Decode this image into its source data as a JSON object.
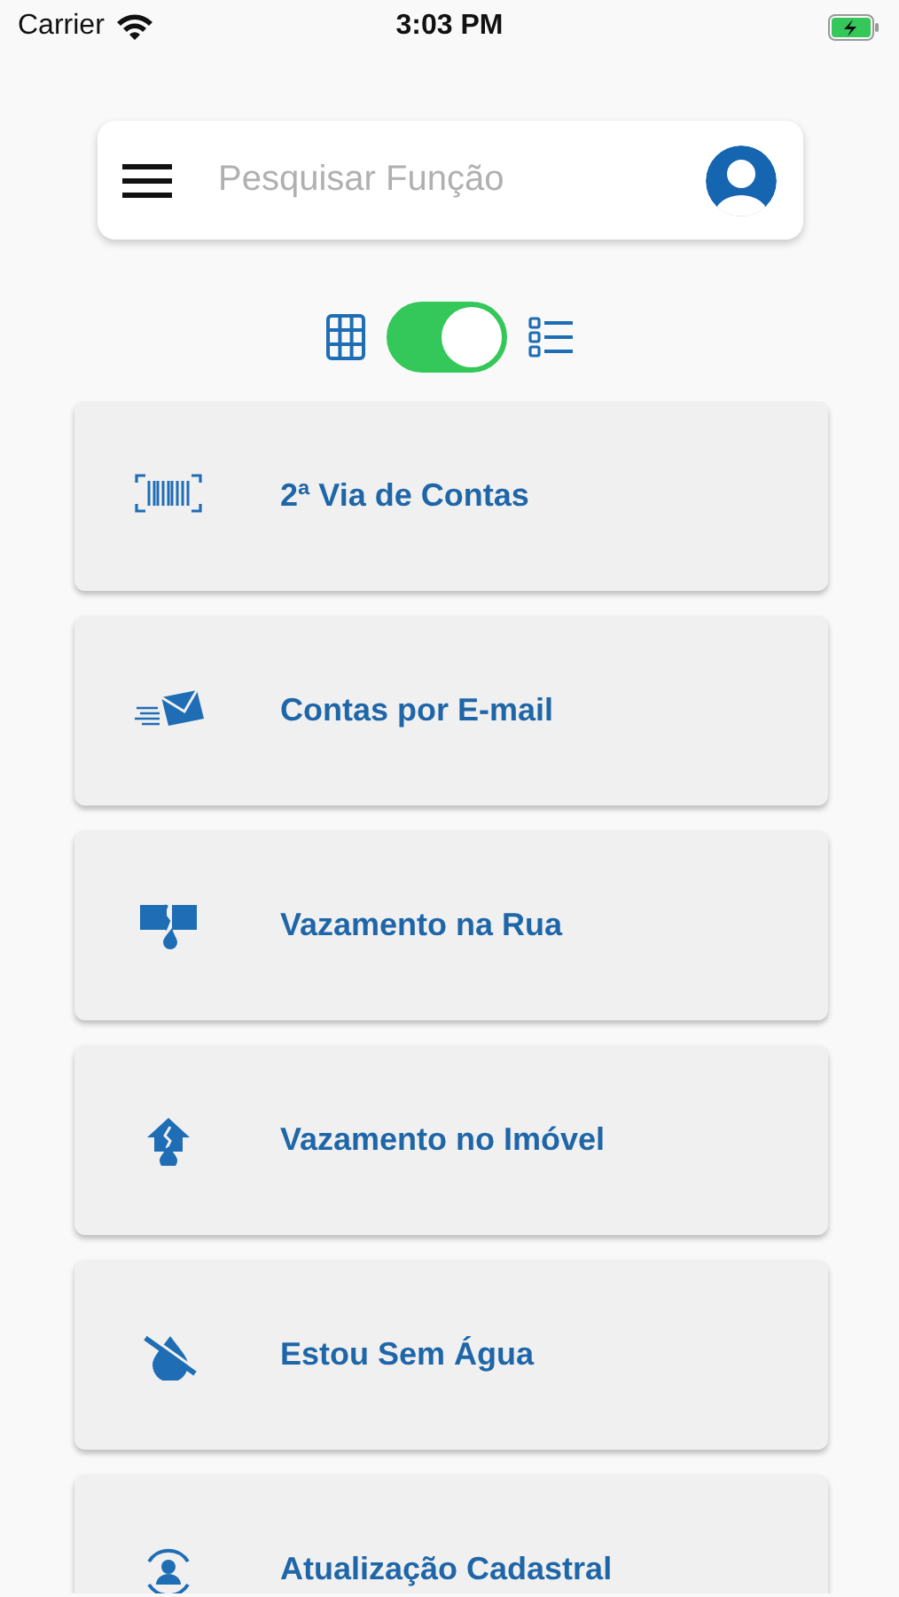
{
  "status_bar": {
    "carrier": "Carrier",
    "time": "3:03 PM",
    "charging": true
  },
  "search": {
    "placeholder": "Pesquisar Função"
  },
  "view_toggle": {
    "on": true
  },
  "services": [
    {
      "label": "2ª Via de Contas",
      "kind": "barcode"
    },
    {
      "label": "Contas por E-mail",
      "kind": "email"
    },
    {
      "label": "Vazamento na Rua",
      "kind": "street-leak"
    },
    {
      "label": "Vazamento no Imóvel",
      "kind": "house-leak"
    },
    {
      "label": "Estou Sem Água",
      "kind": "no-water"
    },
    {
      "label": "Atualização Cadastral",
      "kind": "profile-update"
    }
  ]
}
